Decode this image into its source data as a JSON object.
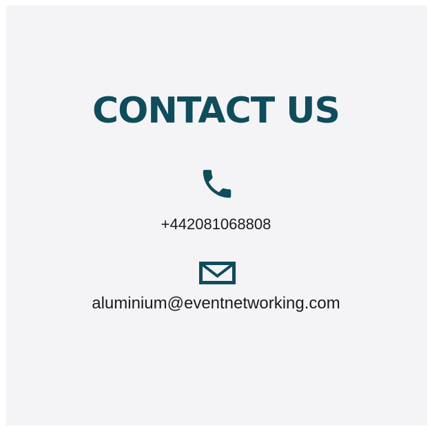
{
  "contact": {
    "title": "CONTACT US",
    "phone": "+442081068808",
    "phone_icon": "phone-icon",
    "email": "aluminium@eventnetworking.com",
    "email_icon": "envelope-icon"
  },
  "colors": {
    "accent": "#0f4c5c",
    "panel_background": "#f4f4f6",
    "text": "#1b1b1b"
  }
}
